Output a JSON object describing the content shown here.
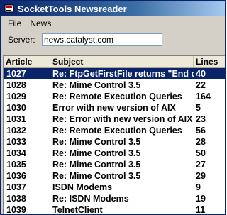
{
  "window": {
    "title": "SocketTools Newsreader"
  },
  "menu": {
    "items": [
      "File",
      "News"
    ]
  },
  "server": {
    "label": "Server:",
    "value": "news.catalyst.com"
  },
  "list": {
    "columns": [
      "Article",
      "Subject",
      "Lines"
    ],
    "rows": [
      {
        "article": "1027",
        "subject": "Re: FtpGetFirstFile returns \"End of",
        "lines": "40",
        "selected": true
      },
      {
        "article": "1028",
        "subject": "Re: Mime Control 3.5",
        "lines": "22"
      },
      {
        "article": "1029",
        "subject": "Re: Remote Execution Queries",
        "lines": "164"
      },
      {
        "article": "1030",
        "subject": "Error with new version of AIX",
        "lines": "5"
      },
      {
        "article": "1031",
        "subject": "Re: Error with new version of AIX",
        "lines": "23"
      },
      {
        "article": "1032",
        "subject": "Re: Remote Execution Queries",
        "lines": "56"
      },
      {
        "article": "1033",
        "subject": "Re: Mime Control 3.5",
        "lines": "28"
      },
      {
        "article": "1034",
        "subject": "Re: Mime Control 3.5",
        "lines": "50"
      },
      {
        "article": "1035",
        "subject": "Re: Mime Control 3.5",
        "lines": "27"
      },
      {
        "article": "1036",
        "subject": "Re: Mime Control 3.5",
        "lines": "29"
      },
      {
        "article": "1037",
        "subject": "ISDN Modems",
        "lines": "9"
      },
      {
        "article": "1038",
        "subject": "Re: ISDN Modems",
        "lines": "19"
      },
      {
        "article": "1039",
        "subject": "TelnetClient",
        "lines": "11"
      }
    ]
  }
}
